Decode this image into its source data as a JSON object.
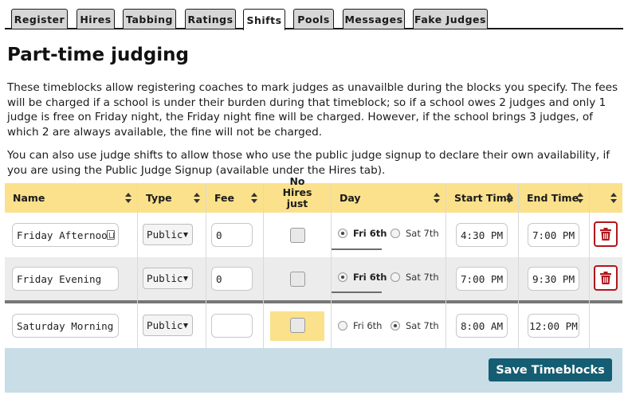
{
  "tabs": [
    "Register",
    "Hires",
    "Tabbing",
    "Ratings",
    "Shifts",
    "Pools",
    "Messages",
    "Fake Judges"
  ],
  "active_tab": "Shifts",
  "page": {
    "title": "Part-time judging",
    "para1": "These timeblocks allow registering coaches to mark judges as unavailble during the blocks you specify. The fees will be charged if a school is under their burden during that timeblock; so if a school owes 2 judges and only 1 judge is free on Friday night, the Friday night fine will be charged. However, if the school brings 3 judges, of which 2 are always available, the fine will not be charged.",
    "para2": "You can also use judge shifts to allow those who use the public judge signup to declare their own availability, if you are using the Public Judge Signup (available under the Hires tab)."
  },
  "columns": {
    "name": "Name",
    "type": "Type",
    "fee": "Fee",
    "nohires": "No Hires just warn",
    "day": "Day",
    "start": "Start Time",
    "end": "End Time"
  },
  "rows": [
    {
      "name": "Friday Afternoon",
      "type": "Public",
      "fee": "0",
      "day": "Fri 6th",
      "day_options": [
        "Fri 6th",
        "Sat 7th"
      ],
      "start": "4:30 PM",
      "end": "7:00 PM",
      "deletable": true
    },
    {
      "name": "Friday Evening",
      "type": "Public",
      "fee": "0",
      "day": "Fri 6th",
      "day_options": [
        "Fri 6th",
        "Sat 7th"
      ],
      "start": "7:00 PM",
      "end": "9:30 PM",
      "deletable": true
    },
    {
      "name": "Saturday Morning",
      "type": "Public",
      "fee": "",
      "day": "Sat 7th",
      "day_options": [
        "Fri 6th",
        "Sat 7th"
      ],
      "start": "8:00 AM",
      "end": "12:00 PM",
      "deletable": false
    }
  ],
  "save_label": "Save Timeblocks",
  "colors": {
    "accent": "#145d73",
    "header": "#fbe18b",
    "delete": "#b0171b",
    "footer": "#c8dde6"
  }
}
